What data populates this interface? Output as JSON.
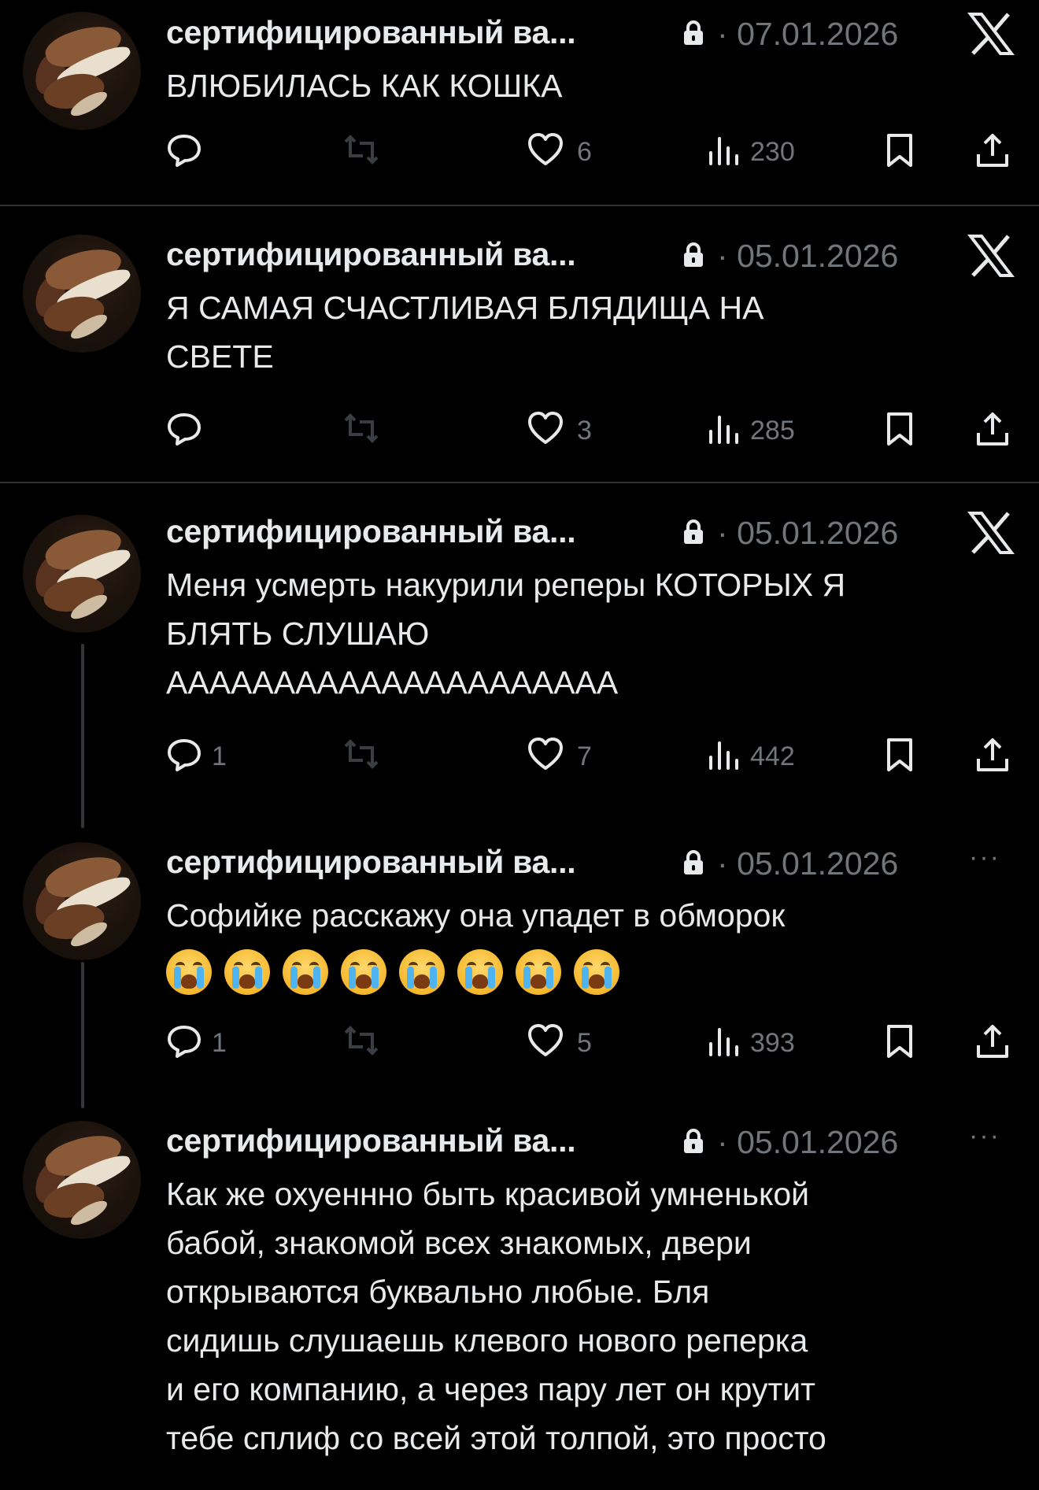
{
  "tweets": [
    {
      "name": "сертифицированный ва...",
      "date": "07.01.2026",
      "text": "ВЛЮБИЛАСЬ КАК КОШКА",
      "replies": "",
      "likes": "6",
      "views": "230",
      "corner_icon": "x-logo-icon"
    },
    {
      "name": "сертифицированный ва...",
      "date": "05.01.2026",
      "text": "Я САМАЯ СЧАСТЛИВАЯ БЛЯДИЩА НА\nСВЕТЕ",
      "replies": "",
      "likes": "3",
      "views": "285",
      "corner_icon": "x-logo-icon"
    },
    {
      "name": "сертифицированный ва...",
      "date": "05.01.2026",
      "text": "Меня усмерть накурили реперы КОТОРЫХ Я\nБЛЯТЬ СЛУШАЮ\nААААААААААААААААААААА",
      "replies": "1",
      "likes": "7",
      "views": "442",
      "corner_icon": "x-logo-icon"
    },
    {
      "name": "сертифицированный ва...",
      "date": "05.01.2026",
      "text": "Софийке расскажу она упадет в обморок",
      "emoji_count": 8,
      "emoji_icon": "loudly-crying-face-emoji",
      "replies": "1",
      "likes": "5",
      "views": "393",
      "corner_icon": "more-icon"
    },
    {
      "name": "сертифицированный ва...",
      "date": "05.01.2026",
      "text": "Как же охуеннно быть красивой умненькой\nбабой, знакомой всех знакомых, двери\nоткрываются буквально любые. Бля\nсидишь слушаешь клевого нового реперка\nи его компанию, а через пару лет он крутит\nтебе сплиф со всей этой толпой, это просто",
      "corner_icon": "more-icon"
    }
  ],
  "separators": {
    "dot": "·",
    "more": "···"
  },
  "colors": {
    "background": "#000000",
    "text": "#e7e9ea",
    "muted": "#71767b",
    "divider": "#2f3336"
  }
}
